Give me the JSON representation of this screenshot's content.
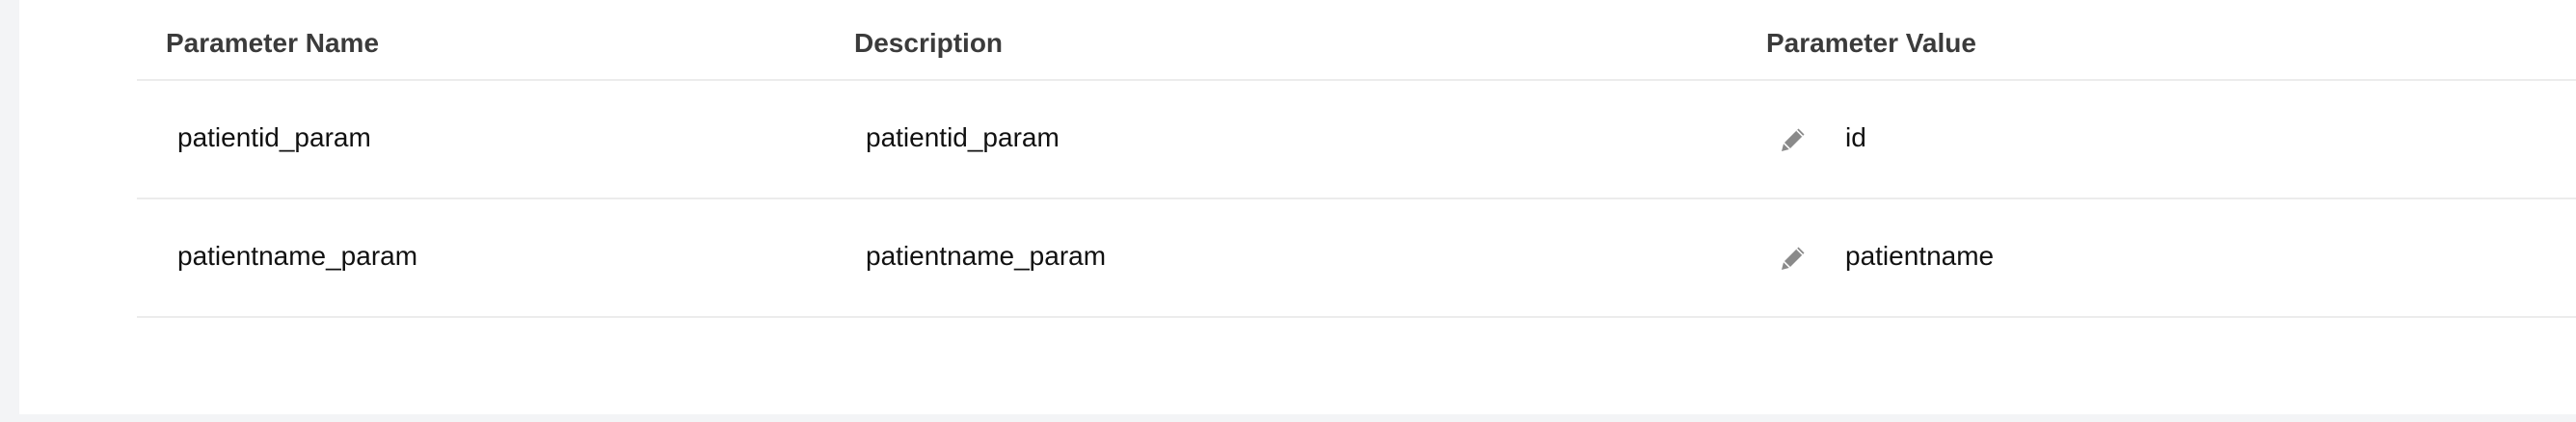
{
  "table": {
    "headers": {
      "name": "Parameter Name",
      "description": "Description",
      "value": "Parameter Value"
    },
    "rows": [
      {
        "name": "patientid_param",
        "description": "patientid_param",
        "value": "id",
        "edit_icon": "pencil-icon"
      },
      {
        "name": "patientname_param",
        "description": "patientname_param",
        "value": "patientname",
        "edit_icon": "pencil-icon"
      }
    ]
  },
  "colors": {
    "header_text": "#3b3b3b",
    "cell_text": "#111111",
    "divider": "#ececec",
    "icon": "#8a8a8a",
    "page_background": "#f3f4f6"
  }
}
